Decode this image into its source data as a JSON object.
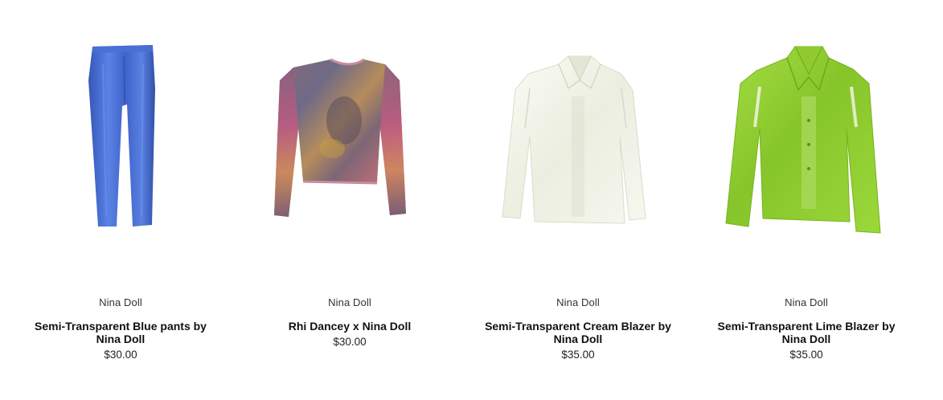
{
  "products": [
    {
      "brand": "Nina Doll",
      "title": "Semi-Transparent Blue pants by Nina Doll",
      "price": "$30.00",
      "image_icon": "blue-pants-image",
      "color": "#4a6fd4"
    },
    {
      "brand": "Nina Doll",
      "title": "Rhi Dancey x Nina Doll",
      "price": "$30.00",
      "image_icon": "printed-longsleeve-top-image",
      "color": "#7a6a78"
    },
    {
      "brand": "Nina Doll",
      "title": "Semi-Transparent Cream Blazer by Nina Doll",
      "price": "$35.00",
      "image_icon": "cream-blazer-image",
      "color": "#f4f3ea"
    },
    {
      "brand": "Nina Doll",
      "title": "Semi-Transparent Lime Blazer by Nina Doll",
      "price": "$35.00",
      "image_icon": "lime-blazer-image",
      "color": "#98d437"
    }
  ]
}
